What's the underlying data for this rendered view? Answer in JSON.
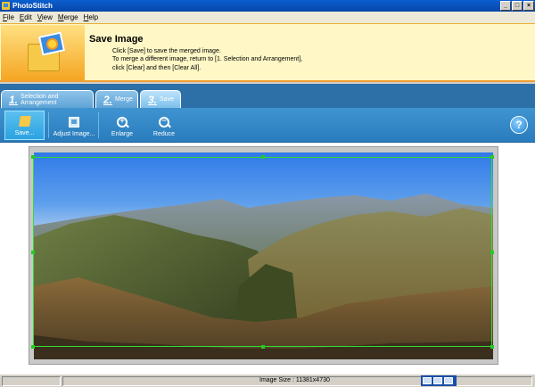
{
  "window": {
    "title": "PhotoStitch",
    "controls": {
      "minimize": "_",
      "maximize": "□",
      "close": "×"
    }
  },
  "menu": [
    "File",
    "Edit",
    "View",
    "Merge",
    "Help"
  ],
  "info": {
    "title": "Save Image",
    "lines": [
      "Click [Save] to save the merged image.",
      "To merge a different image, return to [1. Selection and Arrangement],",
      "click [Clear] and then [Clear All]."
    ]
  },
  "tabs": [
    {
      "num": "1.",
      "label": "Selection and Arrangement"
    },
    {
      "num": "2.",
      "label": "Merge"
    },
    {
      "num": "3.",
      "label": "Save",
      "active": true
    }
  ],
  "toolbar": {
    "save": "Save...",
    "adjust": "Adjust Image...",
    "enlarge": "Enlarge",
    "reduce": "Reduce",
    "help": "?",
    "enlarge_sign": "+",
    "reduce_sign": "−"
  },
  "status": {
    "image_size": "Image Size : 11381x4730"
  },
  "colors": {
    "accent_blue": "#2a7cbd",
    "header_bg": "#fff7c6",
    "selection": "#33dd33"
  }
}
